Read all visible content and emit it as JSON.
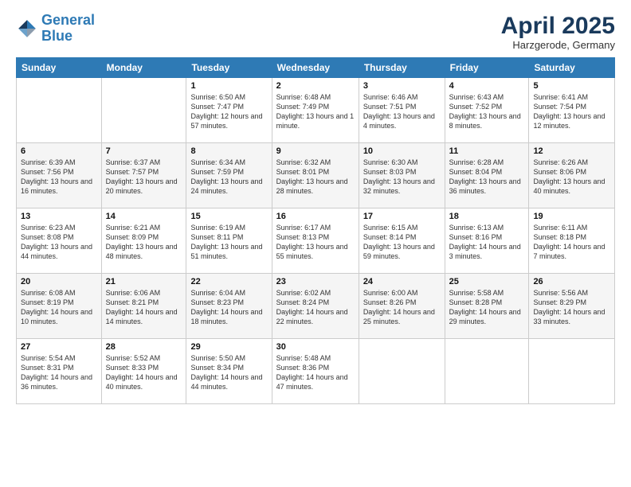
{
  "logo": {
    "line1": "General",
    "line2": "Blue"
  },
  "title": "April 2025",
  "subtitle": "Harzgerode, Germany",
  "days_header": [
    "Sunday",
    "Monday",
    "Tuesday",
    "Wednesday",
    "Thursday",
    "Friday",
    "Saturday"
  ],
  "weeks": [
    [
      {
        "day": "",
        "info": ""
      },
      {
        "day": "",
        "info": ""
      },
      {
        "day": "1",
        "info": "Sunrise: 6:50 AM\nSunset: 7:47 PM\nDaylight: 12 hours and 57 minutes."
      },
      {
        "day": "2",
        "info": "Sunrise: 6:48 AM\nSunset: 7:49 PM\nDaylight: 13 hours and 1 minute."
      },
      {
        "day": "3",
        "info": "Sunrise: 6:46 AM\nSunset: 7:51 PM\nDaylight: 13 hours and 4 minutes."
      },
      {
        "day": "4",
        "info": "Sunrise: 6:43 AM\nSunset: 7:52 PM\nDaylight: 13 hours and 8 minutes."
      },
      {
        "day": "5",
        "info": "Sunrise: 6:41 AM\nSunset: 7:54 PM\nDaylight: 13 hours and 12 minutes."
      }
    ],
    [
      {
        "day": "6",
        "info": "Sunrise: 6:39 AM\nSunset: 7:56 PM\nDaylight: 13 hours and 16 minutes."
      },
      {
        "day": "7",
        "info": "Sunrise: 6:37 AM\nSunset: 7:57 PM\nDaylight: 13 hours and 20 minutes."
      },
      {
        "day": "8",
        "info": "Sunrise: 6:34 AM\nSunset: 7:59 PM\nDaylight: 13 hours and 24 minutes."
      },
      {
        "day": "9",
        "info": "Sunrise: 6:32 AM\nSunset: 8:01 PM\nDaylight: 13 hours and 28 minutes."
      },
      {
        "day": "10",
        "info": "Sunrise: 6:30 AM\nSunset: 8:03 PM\nDaylight: 13 hours and 32 minutes."
      },
      {
        "day": "11",
        "info": "Sunrise: 6:28 AM\nSunset: 8:04 PM\nDaylight: 13 hours and 36 minutes."
      },
      {
        "day": "12",
        "info": "Sunrise: 6:26 AM\nSunset: 8:06 PM\nDaylight: 13 hours and 40 minutes."
      }
    ],
    [
      {
        "day": "13",
        "info": "Sunrise: 6:23 AM\nSunset: 8:08 PM\nDaylight: 13 hours and 44 minutes."
      },
      {
        "day": "14",
        "info": "Sunrise: 6:21 AM\nSunset: 8:09 PM\nDaylight: 13 hours and 48 minutes."
      },
      {
        "day": "15",
        "info": "Sunrise: 6:19 AM\nSunset: 8:11 PM\nDaylight: 13 hours and 51 minutes."
      },
      {
        "day": "16",
        "info": "Sunrise: 6:17 AM\nSunset: 8:13 PM\nDaylight: 13 hours and 55 minutes."
      },
      {
        "day": "17",
        "info": "Sunrise: 6:15 AM\nSunset: 8:14 PM\nDaylight: 13 hours and 59 minutes."
      },
      {
        "day": "18",
        "info": "Sunrise: 6:13 AM\nSunset: 8:16 PM\nDaylight: 14 hours and 3 minutes."
      },
      {
        "day": "19",
        "info": "Sunrise: 6:11 AM\nSunset: 8:18 PM\nDaylight: 14 hours and 7 minutes."
      }
    ],
    [
      {
        "day": "20",
        "info": "Sunrise: 6:08 AM\nSunset: 8:19 PM\nDaylight: 14 hours and 10 minutes."
      },
      {
        "day": "21",
        "info": "Sunrise: 6:06 AM\nSunset: 8:21 PM\nDaylight: 14 hours and 14 minutes."
      },
      {
        "day": "22",
        "info": "Sunrise: 6:04 AM\nSunset: 8:23 PM\nDaylight: 14 hours and 18 minutes."
      },
      {
        "day": "23",
        "info": "Sunrise: 6:02 AM\nSunset: 8:24 PM\nDaylight: 14 hours and 22 minutes."
      },
      {
        "day": "24",
        "info": "Sunrise: 6:00 AM\nSunset: 8:26 PM\nDaylight: 14 hours and 25 minutes."
      },
      {
        "day": "25",
        "info": "Sunrise: 5:58 AM\nSunset: 8:28 PM\nDaylight: 14 hours and 29 minutes."
      },
      {
        "day": "26",
        "info": "Sunrise: 5:56 AM\nSunset: 8:29 PM\nDaylight: 14 hours and 33 minutes."
      }
    ],
    [
      {
        "day": "27",
        "info": "Sunrise: 5:54 AM\nSunset: 8:31 PM\nDaylight: 14 hours and 36 minutes."
      },
      {
        "day": "28",
        "info": "Sunrise: 5:52 AM\nSunset: 8:33 PM\nDaylight: 14 hours and 40 minutes."
      },
      {
        "day": "29",
        "info": "Sunrise: 5:50 AM\nSunset: 8:34 PM\nDaylight: 14 hours and 44 minutes."
      },
      {
        "day": "30",
        "info": "Sunrise: 5:48 AM\nSunset: 8:36 PM\nDaylight: 14 hours and 47 minutes."
      },
      {
        "day": "",
        "info": ""
      },
      {
        "day": "",
        "info": ""
      },
      {
        "day": "",
        "info": ""
      }
    ]
  ]
}
